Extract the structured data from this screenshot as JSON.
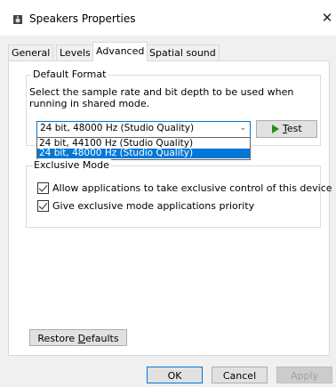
{
  "window": {
    "title": "Speakers Properties",
    "close_glyph": "✕"
  },
  "tabs": [
    {
      "label": "General",
      "active": false
    },
    {
      "label": "Levels",
      "active": false
    },
    {
      "label": "Advanced",
      "active": true
    },
    {
      "label": "Spatial sound",
      "active": false
    }
  ],
  "default_format": {
    "group_label": "Default Format",
    "description": "Select the sample rate and bit depth to be used when running in shared mode.",
    "selected_value": "24 bit, 48000 Hz (Studio Quality)",
    "options": [
      {
        "label": "24 bit, 44100 Hz (Studio Quality)",
        "highlighted": false
      },
      {
        "label": "24 bit, 48000 Hz (Studio Quality)",
        "highlighted": true
      }
    ],
    "test_label_prefix": "T",
    "test_label_rest": "est"
  },
  "exclusive_mode": {
    "group_label": "Exclusive Mode",
    "options": [
      {
        "label": "Allow applications to take exclusive control of this device",
        "checked": true
      },
      {
        "label": "Give exclusive mode applications priority",
        "checked": true
      }
    ]
  },
  "restore": {
    "label_prefix": "Restore ",
    "label_accel": "D",
    "label_rest": "efaults"
  },
  "footer": {
    "ok": "OK",
    "cancel": "Cancel",
    "apply": "Apply"
  },
  "colors": {
    "accent": "#0078d7",
    "play_icon": "#1f8f1f"
  }
}
